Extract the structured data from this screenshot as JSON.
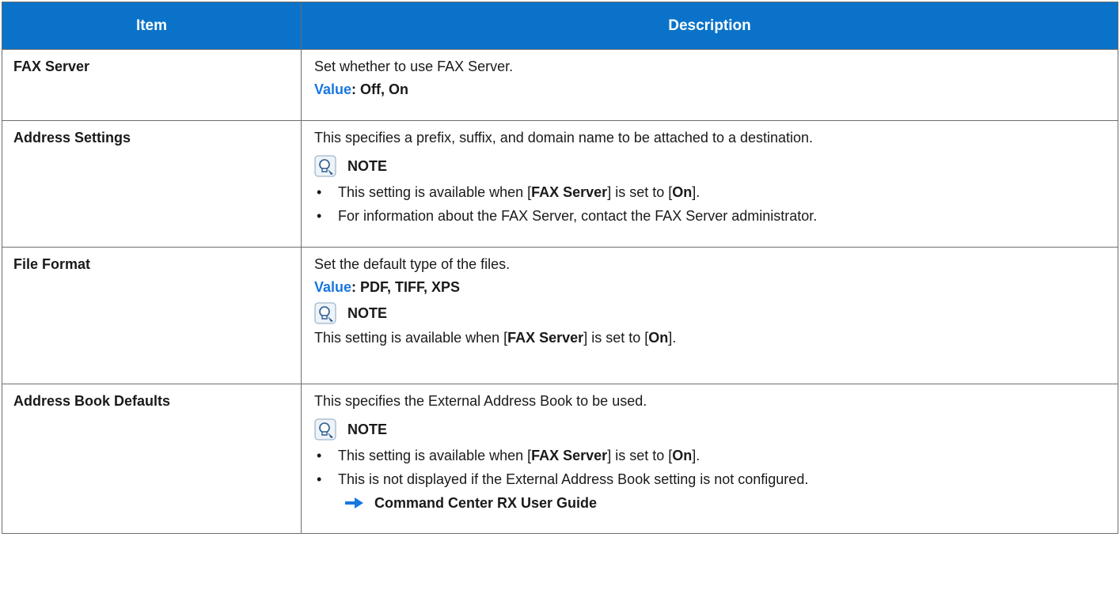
{
  "header": {
    "item": "Item",
    "description": "Description"
  },
  "rows": [
    {
      "item": "FAX Server",
      "desc": "Set whether to use FAX Server.",
      "value_label": "Value",
      "value_sep": ":",
      "value_text": " Off, On"
    },
    {
      "item": "Address Settings",
      "desc": "This specifies a prefix, suffix, and domain name to be attached to a destination.",
      "note_label": "NOTE",
      "bullets": [
        {
          "pre": "This setting is available when [",
          "b1": "FAX Server",
          "mid": "] is set to [",
          "b2": "On",
          "post": "]."
        },
        {
          "text": "For information about the FAX Server, contact the FAX Server administrator."
        }
      ]
    },
    {
      "item": "File Format",
      "desc": "Set the default type of the files.",
      "value_label": "Value",
      "value_sep": ":",
      "value_text": " PDF, TIFF, XPS",
      "note_label": "NOTE",
      "note_line": {
        "pre": "This setting is available when [",
        "b1": "FAX Server",
        "mid": "] is set to [",
        "b2": "On",
        "post": "]."
      }
    },
    {
      "item": "Address Book Defaults",
      "desc": "This specifies the External Address Book to be used.",
      "note_label": "NOTE",
      "bullets": [
        {
          "pre": "This setting is available when [",
          "b1": "FAX Server",
          "mid": "] is set to [",
          "b2": "On",
          "post": "]."
        },
        {
          "text": "This is not displayed if the External Address Book setting is not configured."
        }
      ],
      "ref": "Command Center RX User Guide"
    }
  ],
  "bullet_char": "•",
  "colors": {
    "header_bg": "#0a73c9",
    "value_label": "#1877e0",
    "border": "#6d6d6d"
  },
  "icons": {
    "note": "lightbulb-note-icon",
    "reference": "right-arrow-icon"
  }
}
